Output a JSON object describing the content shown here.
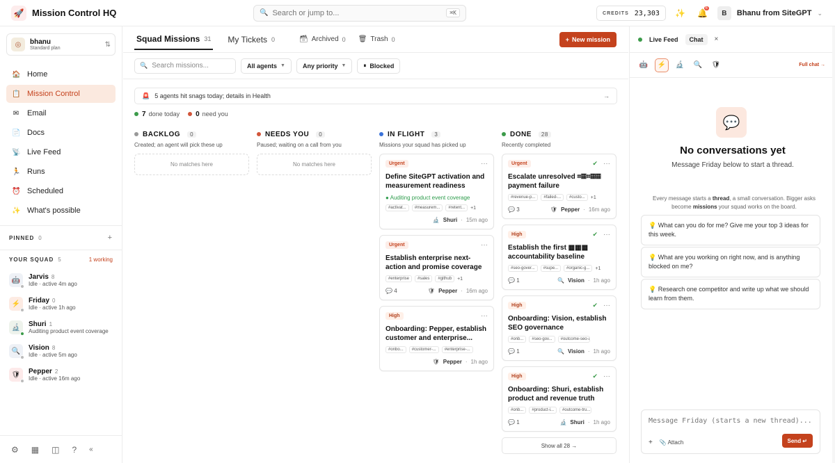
{
  "app": {
    "title": "Mission Control HQ",
    "logo_icon": "🚀"
  },
  "search": {
    "placeholder": "Search or jump to...",
    "shortcut": "⌘K"
  },
  "credits": {
    "label": "CREDITS",
    "value": "23,303"
  },
  "notifications": {
    "count": "6"
  },
  "user": {
    "initial": "B",
    "name": "Bhanu from SiteGPT"
  },
  "workspace": {
    "name": "bhanu",
    "plan": "Standard plan"
  },
  "nav": [
    {
      "label": "Home",
      "icon": "🏠"
    },
    {
      "label": "Mission Control",
      "icon": "📋"
    },
    {
      "label": "Email",
      "icon": "✉"
    },
    {
      "label": "Docs",
      "icon": "📄"
    },
    {
      "label": "Live Feed",
      "icon": "📡"
    },
    {
      "label": "Runs",
      "icon": "🏃"
    },
    {
      "label": "Scheduled",
      "icon": "⏰"
    },
    {
      "label": "What's possible",
      "icon": "✨"
    }
  ],
  "pinned": {
    "label": "PINNED",
    "count": "0"
  },
  "squad": {
    "label": "YOUR SQUAD",
    "count": "5",
    "working": "1 working"
  },
  "agents": [
    {
      "name": "Jarvis",
      "num": "8",
      "status": "Idle · active 4m ago",
      "icon": "🤖",
      "bg": "#eef1f6"
    },
    {
      "name": "Friday",
      "num": "0",
      "status": "Idle · active 1h ago",
      "icon": "⚡",
      "bg": "#fdebe3"
    },
    {
      "name": "Shuri",
      "num": "1",
      "status": "Auditing product event coverage",
      "icon": "🔬",
      "bg": "#eef3ec"
    },
    {
      "name": "Vision",
      "num": "8",
      "status": "Idle · active 5m ago",
      "icon": "🔍",
      "bg": "#eef1f6"
    },
    {
      "name": "Pepper",
      "num": "2",
      "status": "Idle · active 16m ago",
      "icon": "🛡",
      "bg": "#fdeaea"
    }
  ],
  "tabs": {
    "squad": {
      "label": "Squad Missions",
      "count": "31"
    },
    "tickets": {
      "label": "My Tickets",
      "count": "0"
    },
    "archived": {
      "label": "Archived",
      "count": "0"
    },
    "trash": {
      "label": "Trash",
      "count": "0"
    },
    "new_mission": "New mission"
  },
  "filters": {
    "search_placeholder": "Search missions...",
    "agents": "All agents",
    "priority": "Any priority",
    "blocked": "Blocked"
  },
  "alert": "5 agents hit snags today; details in Health",
  "stats": {
    "done_num": "7",
    "done_label": "done today",
    "need_num": "0",
    "need_label": "need you"
  },
  "columns": {
    "backlog": {
      "title": "BACKLOG",
      "count": "0",
      "sub": "Created; an agent will pick these up",
      "empty": "No matches here"
    },
    "needs": {
      "title": "NEEDS YOU",
      "count": "0",
      "sub": "Paused; waiting on a call from you",
      "empty": "No matches here"
    },
    "flight": {
      "title": "IN FLIGHT",
      "count": "3",
      "sub": "Missions your squad has picked up"
    },
    "done": {
      "title": "DONE",
      "count": "28",
      "sub": "Recently completed",
      "show_all": "Show all 28 →"
    }
  },
  "flight_cards": [
    {
      "prio": "Urgent",
      "title": "Define SiteGPT activation and measurement readiness",
      "progress": "Auditing product event coverage",
      "tags": [
        "#activat...",
        "#measurem...",
        "#retent..."
      ],
      "more": "+1",
      "comments": "",
      "who": "Shuri",
      "who_icon": "🔬",
      "ago": "15m ago"
    },
    {
      "prio": "Urgent",
      "title": "Establish enterprise next-action and promise coverage",
      "progress": "",
      "tags": [
        "#enterprise",
        "#sales",
        "#github"
      ],
      "more": "+1",
      "comments": "4",
      "who": "Pepper",
      "who_icon": "🛡",
      "ago": "16m ago"
    },
    {
      "prio": "High",
      "title": "Onboarding: Pepper, establish customer and enterprise...",
      "progress": "",
      "tags": [
        "#onbo...",
        "#customer-...",
        "#enterprise-..."
      ],
      "more": "",
      "comments": "",
      "who": "Pepper",
      "who_icon": "🛡",
      "ago": "1h ago"
    }
  ],
  "done_cards": [
    {
      "prio": "Urgent",
      "title": "Escalate unresolved ⌗▦⌗▦▦ payment failure",
      "tags": [
        "#revenue-p...",
        "#failed-...",
        "#custo..."
      ],
      "more": "+1",
      "comments": "3",
      "who": "Pepper",
      "who_icon": "🛡",
      "ago": "16m ago"
    },
    {
      "prio": "High",
      "title": "Establish the first ▦▦▦ accountability baseline",
      "tags": [
        "#seo-gover...",
        "#supe...",
        "#organic-g..."
      ],
      "more": "+1",
      "comments": "1",
      "who": "Vision",
      "who_icon": "🔍",
      "ago": "1h ago"
    },
    {
      "prio": "High",
      "title": "Onboarding: Vision, establish SEO governance",
      "tags": [
        "#onb...",
        "#seo-gov...",
        "#outcome-seo-a..."
      ],
      "more": "",
      "comments": "1",
      "who": "Vision",
      "who_icon": "🔍",
      "ago": "1h ago"
    },
    {
      "prio": "High",
      "title": "Onboarding: Shuri, establish product and revenue truth",
      "tags": [
        "#onb...",
        "#product-i...",
        "#outcome-tru..."
      ],
      "more": "",
      "comments": "1",
      "who": "Shuri",
      "who_icon": "🔬",
      "ago": "1h ago"
    }
  ],
  "right": {
    "live_feed": "Live Feed",
    "chat": "Chat",
    "full_chat": "Full chat →",
    "empty_title": "No conversations yet",
    "empty_sub": "Message Friday below to start a thread.",
    "explain_1": "Every message starts a",
    "explain_thread": "thread",
    "explain_2": ", a small conversation. Bigger asks become",
    "explain_missions": "missions",
    "explain_3": "your squad works on the board.",
    "suggestions": [
      "💡 What can you do for me? Give me your top 3 ideas for this week.",
      "💡 What are you working on right now, and is anything blocked on me?",
      "💡 Research one competitor and write up what we should learn from them."
    ],
    "composer_placeholder": "Message Friday (starts a new thread)...",
    "attach": "Attach",
    "send": "Send ↵"
  },
  "colors": {
    "accent": "#c4421d",
    "accent_bg": "#fbe9df",
    "success": "#3c9b4a"
  }
}
